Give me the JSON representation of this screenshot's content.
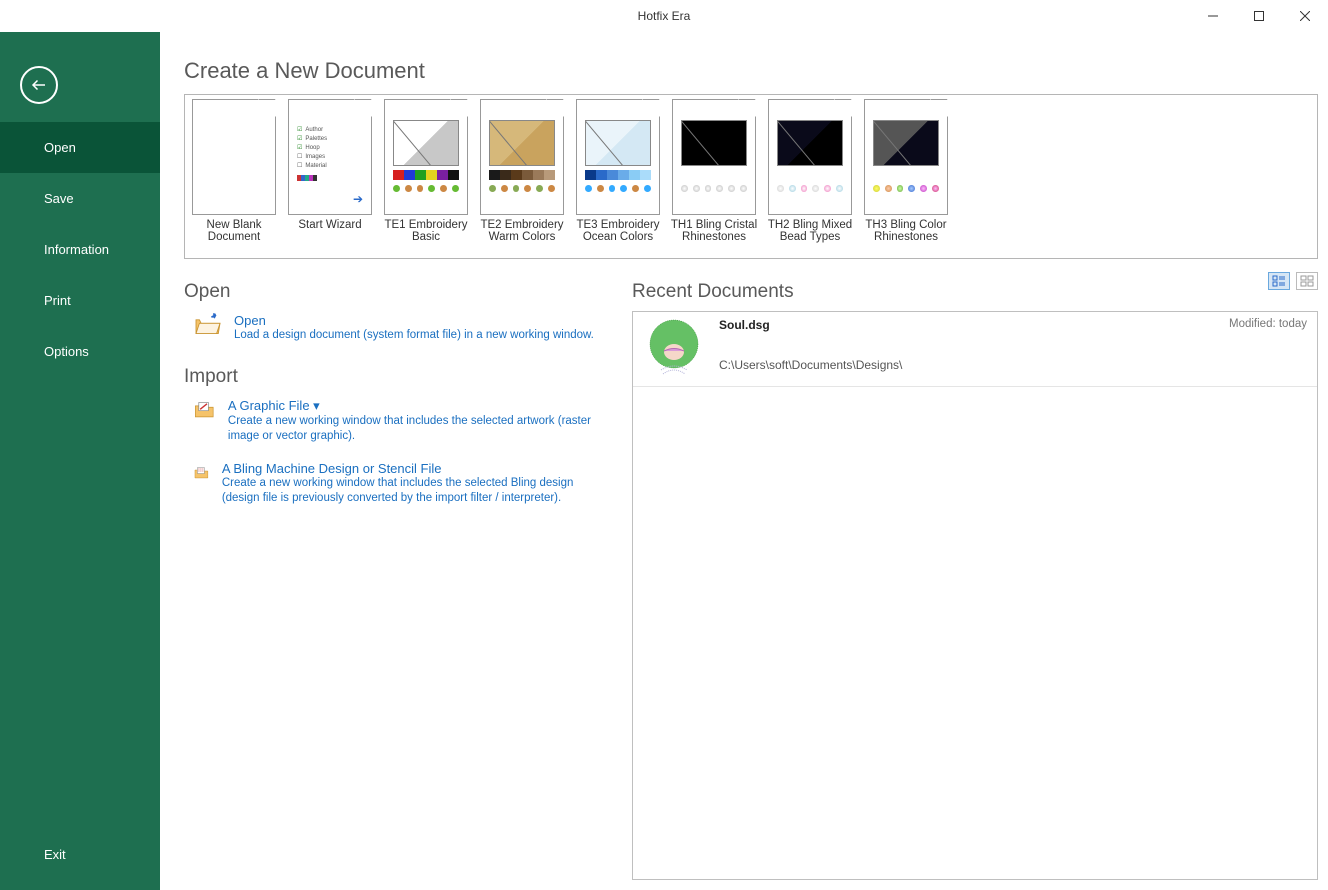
{
  "window": {
    "title": "Hotfix Era"
  },
  "sidebar": {
    "items": [
      "Open",
      "Save",
      "Information",
      "Print",
      "Options"
    ],
    "active_index": 0,
    "exit": "Exit"
  },
  "headings": {
    "create": "Create a New Document",
    "open": "Open",
    "import": "Import",
    "recent": "Recent Documents"
  },
  "templates": [
    {
      "label": "New Blank Document"
    },
    {
      "label": "Start Wizard"
    },
    {
      "label": "TE1 Embroidery Basic"
    },
    {
      "label": "TE2 Embroidery Warm Colors"
    },
    {
      "label": "TE3 Embroidery Ocean Colors"
    },
    {
      "label": "TH1 Bling Cristal Rhinestones"
    },
    {
      "label": "TH2 Bling Mixed Bead Types"
    },
    {
      "label": "TH3 Bling Color Rhinestones"
    }
  ],
  "open_action": {
    "title": "Open",
    "desc": "Load a design document (system format file) in a new working window."
  },
  "import_actions": [
    {
      "title": "A Graphic File ▾",
      "desc": "Create a new working window that includes the selected artwork (raster image or vector graphic)."
    },
    {
      "title": "A Bling Machine Design or Stencil File",
      "desc": "Create a new working window that includes the selected Bling design (design file is previously converted by the import filter / interpreter)."
    }
  ],
  "recent": [
    {
      "name": "Soul.dsg",
      "path": "C:\\Users\\soft\\Documents\\Designs\\",
      "modified": "Modified: today"
    }
  ]
}
